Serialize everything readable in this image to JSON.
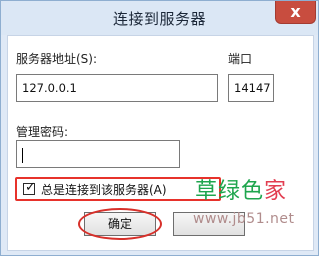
{
  "window": {
    "title": "连接到服务器",
    "close_glyph": "x"
  },
  "form": {
    "server_address_label": "服务器地址(S):",
    "server_address_value": "127.0.0.1",
    "port_label": "端口",
    "port_value": "14147",
    "password_label": "管理密码:",
    "password_value": "",
    "always_connect_label": "总是连接到该服务器(A)",
    "always_connect_checked": true
  },
  "buttons": {
    "ok_label": "确定"
  },
  "watermark": {
    "main_left": "草绿色",
    "main_right": "家",
    "sub": "www.jb51.net"
  },
  "colors": {
    "highlight": "#e7322b",
    "watermark_green": "#1ea54d",
    "watermark_red": "#e23d50",
    "close_button": "#c84d3f"
  }
}
